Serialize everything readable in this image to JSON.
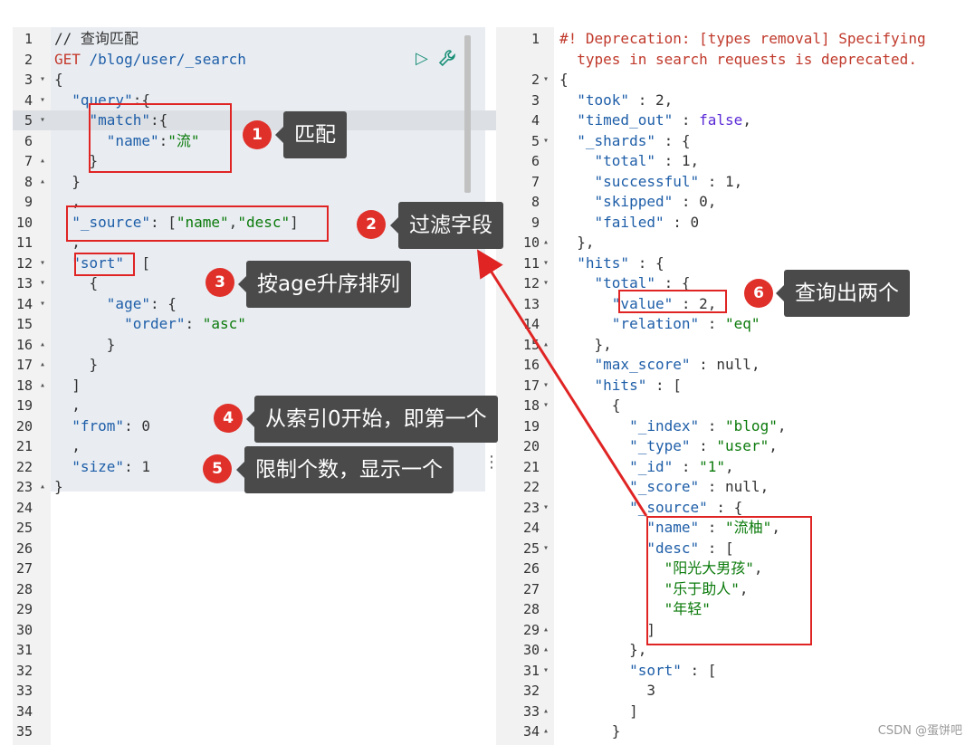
{
  "left_editor": {
    "lines": [
      {
        "n": "1",
        "fold": "",
        "html": [
          [
            "c-cmt",
            "// 查询匹配"
          ]
        ]
      },
      {
        "n": "2",
        "fold": "",
        "html": [
          [
            "c-meth",
            "GET"
          ],
          [
            "c-key",
            " /blog/user/_search"
          ]
        ]
      },
      {
        "n": "3",
        "fold": "▾",
        "html": [
          [
            "c-pun",
            "{"
          ]
        ]
      },
      {
        "n": "4",
        "fold": "▾",
        "html": [
          [
            "c-key",
            "  \"query\""
          ],
          [
            "c-pun",
            ":{"
          ]
        ]
      },
      {
        "n": "5",
        "fold": "▾",
        "html": [
          [
            "c-key",
            "    \"match\""
          ],
          [
            "c-pun",
            ":{"
          ]
        ]
      },
      {
        "n": "6",
        "fold": "",
        "html": [
          [
            "c-key",
            "      \"name\""
          ],
          [
            "c-pun",
            ":"
          ],
          [
            "c-str",
            "\"流\""
          ]
        ]
      },
      {
        "n": "7",
        "fold": "▴",
        "html": [
          [
            "c-pun",
            "    }"
          ]
        ]
      },
      {
        "n": "8",
        "fold": "▴",
        "html": [
          [
            "c-pun",
            "  }"
          ]
        ]
      },
      {
        "n": "9",
        "fold": "",
        "html": [
          [
            "c-pun",
            "  ,"
          ]
        ]
      },
      {
        "n": "10",
        "fold": "",
        "html": [
          [
            "c-key",
            "  \"_source\""
          ],
          [
            "c-pun",
            ": ["
          ],
          [
            "c-str",
            "\"name\""
          ],
          [
            "c-pun",
            ","
          ],
          [
            "c-str",
            "\"desc\""
          ],
          [
            "c-pun",
            "]"
          ]
        ]
      },
      {
        "n": "11",
        "fold": "",
        "html": [
          [
            "c-pun",
            "  ,"
          ]
        ]
      },
      {
        "n": "12",
        "fold": "▾",
        "html": [
          [
            "c-key",
            "  \"sort\""
          ],
          [
            "c-pun",
            "  ["
          ]
        ]
      },
      {
        "n": "13",
        "fold": "▾",
        "html": [
          [
            "c-pun",
            "    {"
          ]
        ]
      },
      {
        "n": "14",
        "fold": "▾",
        "html": [
          [
            "c-key",
            "      \"age\""
          ],
          [
            "c-pun",
            ": {"
          ]
        ]
      },
      {
        "n": "15",
        "fold": "",
        "html": [
          [
            "c-key",
            "        \"order\""
          ],
          [
            "c-pun",
            ": "
          ],
          [
            "c-str",
            "\"asc\""
          ]
        ]
      },
      {
        "n": "16",
        "fold": "▴",
        "html": [
          [
            "c-pun",
            "      }"
          ]
        ]
      },
      {
        "n": "17",
        "fold": "▴",
        "html": [
          [
            "c-pun",
            "    }"
          ]
        ]
      },
      {
        "n": "18",
        "fold": "▴",
        "html": [
          [
            "c-pun",
            "  ]"
          ]
        ]
      },
      {
        "n": "19",
        "fold": "",
        "html": [
          [
            "c-pun",
            "  ,"
          ]
        ]
      },
      {
        "n": "20",
        "fold": "",
        "html": [
          [
            "c-key",
            "  \"from\""
          ],
          [
            "c-pun",
            ": "
          ],
          [
            "c-num",
            "0"
          ]
        ]
      },
      {
        "n": "21",
        "fold": "",
        "html": [
          [
            "c-pun",
            "  ,"
          ]
        ]
      },
      {
        "n": "22",
        "fold": "",
        "html": [
          [
            "c-key",
            "  \"size\""
          ],
          [
            "c-pun",
            ": "
          ],
          [
            "c-num",
            "1"
          ]
        ]
      },
      {
        "n": "23",
        "fold": "▴",
        "html": [
          [
            "c-pun",
            "}"
          ]
        ]
      },
      {
        "n": "24",
        "fold": "",
        "html": []
      },
      {
        "n": "25",
        "fold": "",
        "html": []
      },
      {
        "n": "26",
        "fold": "",
        "html": []
      },
      {
        "n": "27",
        "fold": "",
        "html": []
      },
      {
        "n": "28",
        "fold": "",
        "html": []
      },
      {
        "n": "29",
        "fold": "",
        "html": []
      },
      {
        "n": "30",
        "fold": "",
        "html": []
      },
      {
        "n": "31",
        "fold": "",
        "html": []
      },
      {
        "n": "32",
        "fold": "",
        "html": []
      },
      {
        "n": "33",
        "fold": "",
        "html": []
      },
      {
        "n": "34",
        "fold": "",
        "html": []
      },
      {
        "n": "35",
        "fold": "",
        "html": []
      }
    ]
  },
  "right_editor": {
    "lines": [
      {
        "n": "1",
        "fold": "",
        "html": [
          [
            "c-warn",
            "#! Deprecation: [types removal] Specifying"
          ]
        ]
      },
      {
        "n": "",
        "fold": "",
        "html": [
          [
            "c-warn",
            "  types in search requests is deprecated."
          ]
        ]
      },
      {
        "n": "2",
        "fold": "▾",
        "html": [
          [
            "c-pun",
            "{"
          ]
        ]
      },
      {
        "n": "3",
        "fold": "",
        "html": [
          [
            "c-key",
            "  \"took\""
          ],
          [
            "c-pun",
            " : "
          ],
          [
            "c-num",
            "2"
          ],
          [
            "c-pun",
            ","
          ]
        ]
      },
      {
        "n": "4",
        "fold": "",
        "html": [
          [
            "c-key",
            "  \"timed_out\""
          ],
          [
            "c-pun",
            " : "
          ],
          [
            "c-bool",
            "false"
          ],
          [
            "c-pun",
            ","
          ]
        ]
      },
      {
        "n": "5",
        "fold": "▾",
        "html": [
          [
            "c-key",
            "  \"_shards\""
          ],
          [
            "c-pun",
            " : {"
          ]
        ]
      },
      {
        "n": "6",
        "fold": "",
        "html": [
          [
            "c-key",
            "    \"total\""
          ],
          [
            "c-pun",
            " : "
          ],
          [
            "c-num",
            "1"
          ],
          [
            "c-pun",
            ","
          ]
        ]
      },
      {
        "n": "7",
        "fold": "",
        "html": [
          [
            "c-key",
            "    \"successful\""
          ],
          [
            "c-pun",
            " : "
          ],
          [
            "c-num",
            "1"
          ],
          [
            "c-pun",
            ","
          ]
        ]
      },
      {
        "n": "8",
        "fold": "",
        "html": [
          [
            "c-key",
            "    \"skipped\""
          ],
          [
            "c-pun",
            " : "
          ],
          [
            "c-num",
            "0"
          ],
          [
            "c-pun",
            ","
          ]
        ]
      },
      {
        "n": "9",
        "fold": "",
        "html": [
          [
            "c-key",
            "    \"failed\""
          ],
          [
            "c-pun",
            " : "
          ],
          [
            "c-num",
            "0"
          ]
        ]
      },
      {
        "n": "10",
        "fold": "▴",
        "html": [
          [
            "c-pun",
            "  },"
          ]
        ]
      },
      {
        "n": "11",
        "fold": "▾",
        "html": [
          [
            "c-key",
            "  \"hits\""
          ],
          [
            "c-pun",
            " : {"
          ]
        ]
      },
      {
        "n": "12",
        "fold": "▾",
        "html": [
          [
            "c-key",
            "    \"total\""
          ],
          [
            "c-pun",
            " : {"
          ]
        ]
      },
      {
        "n": "13",
        "fold": "",
        "html": [
          [
            "c-key",
            "      \"value\""
          ],
          [
            "c-pun",
            " : "
          ],
          [
            "c-num",
            "2"
          ],
          [
            "c-pun",
            ","
          ]
        ]
      },
      {
        "n": "14",
        "fold": "",
        "html": [
          [
            "c-key",
            "      \"relation\""
          ],
          [
            "c-pun",
            " : "
          ],
          [
            "c-str",
            "\"eq\""
          ]
        ]
      },
      {
        "n": "15",
        "fold": "▴",
        "html": [
          [
            "c-pun",
            "    },"
          ]
        ]
      },
      {
        "n": "16",
        "fold": "",
        "html": [
          [
            "c-key",
            "    \"max_score\""
          ],
          [
            "c-pun",
            " : "
          ],
          [
            "c-num",
            "null"
          ],
          [
            "c-pun",
            ","
          ]
        ]
      },
      {
        "n": "17",
        "fold": "▾",
        "html": [
          [
            "c-key",
            "    \"hits\""
          ],
          [
            "c-pun",
            " : ["
          ]
        ]
      },
      {
        "n": "18",
        "fold": "▾",
        "html": [
          [
            "c-pun",
            "      {"
          ]
        ]
      },
      {
        "n": "19",
        "fold": "",
        "html": [
          [
            "c-key",
            "        \"_index\""
          ],
          [
            "c-pun",
            " : "
          ],
          [
            "c-str",
            "\"blog\""
          ],
          [
            "c-pun",
            ","
          ]
        ]
      },
      {
        "n": "20",
        "fold": "",
        "html": [
          [
            "c-key",
            "        \"_type\""
          ],
          [
            "c-pun",
            " : "
          ],
          [
            "c-str",
            "\"user\""
          ],
          [
            "c-pun",
            ","
          ]
        ]
      },
      {
        "n": "21",
        "fold": "",
        "html": [
          [
            "c-key",
            "        \"_id\""
          ],
          [
            "c-pun",
            " : "
          ],
          [
            "c-str",
            "\"1\""
          ],
          [
            "c-pun",
            ","
          ]
        ]
      },
      {
        "n": "22",
        "fold": "",
        "html": [
          [
            "c-key",
            "        \"_score\""
          ],
          [
            "c-pun",
            " : "
          ],
          [
            "c-num",
            "null"
          ],
          [
            "c-pun",
            ","
          ]
        ]
      },
      {
        "n": "23",
        "fold": "▾",
        "html": [
          [
            "c-key",
            "        \"_source\""
          ],
          [
            "c-pun",
            " : {"
          ]
        ]
      },
      {
        "n": "24",
        "fold": "",
        "html": [
          [
            "c-key",
            "          \"name\""
          ],
          [
            "c-pun",
            " : "
          ],
          [
            "c-str",
            "\"流柚\""
          ],
          [
            "c-pun",
            ","
          ]
        ]
      },
      {
        "n": "25",
        "fold": "▾",
        "html": [
          [
            "c-key",
            "          \"desc\""
          ],
          [
            "c-pun",
            " : ["
          ]
        ]
      },
      {
        "n": "26",
        "fold": "",
        "html": [
          [
            "c-str",
            "            \"阳光大男孩\""
          ],
          [
            "c-pun",
            ","
          ]
        ]
      },
      {
        "n": "27",
        "fold": "",
        "html": [
          [
            "c-str",
            "            \"乐于助人\""
          ],
          [
            "c-pun",
            ","
          ]
        ]
      },
      {
        "n": "28",
        "fold": "",
        "html": [
          [
            "c-str",
            "            \"年轻\""
          ]
        ]
      },
      {
        "n": "29",
        "fold": "▴",
        "html": [
          [
            "c-pun",
            "          ]"
          ]
        ]
      },
      {
        "n": "30",
        "fold": "▴",
        "html": [
          [
            "c-pun",
            "        },"
          ]
        ]
      },
      {
        "n": "31",
        "fold": "▾",
        "html": [
          [
            "c-key",
            "        \"sort\""
          ],
          [
            "c-pun",
            " : ["
          ]
        ]
      },
      {
        "n": "32",
        "fold": "",
        "html": [
          [
            "c-num",
            "          3"
          ]
        ]
      },
      {
        "n": "33",
        "fold": "▴",
        "html": [
          [
            "c-pun",
            "        ]"
          ]
        ]
      },
      {
        "n": "34",
        "fold": "▴",
        "html": [
          [
            "c-pun",
            "      }"
          ]
        ]
      }
    ]
  },
  "annotations": [
    {
      "num": "1",
      "label": "匹配"
    },
    {
      "num": "2",
      "label": "过滤字段"
    },
    {
      "num": "3",
      "label": "按age升序排列"
    },
    {
      "num": "4",
      "label": "从索引0开始，即第一个"
    },
    {
      "num": "5",
      "label": "限制个数，显示一个"
    },
    {
      "num": "6",
      "label": "查询出两个"
    }
  ],
  "watermark": "CSDN @蛋饼吧",
  "icons": {
    "run": "play-icon",
    "settings": "wrench-icon",
    "menu": "kebab-menu-icon"
  },
  "colors": {
    "highlight": "#e02424",
    "callout_bg": "#4a4a4a"
  }
}
